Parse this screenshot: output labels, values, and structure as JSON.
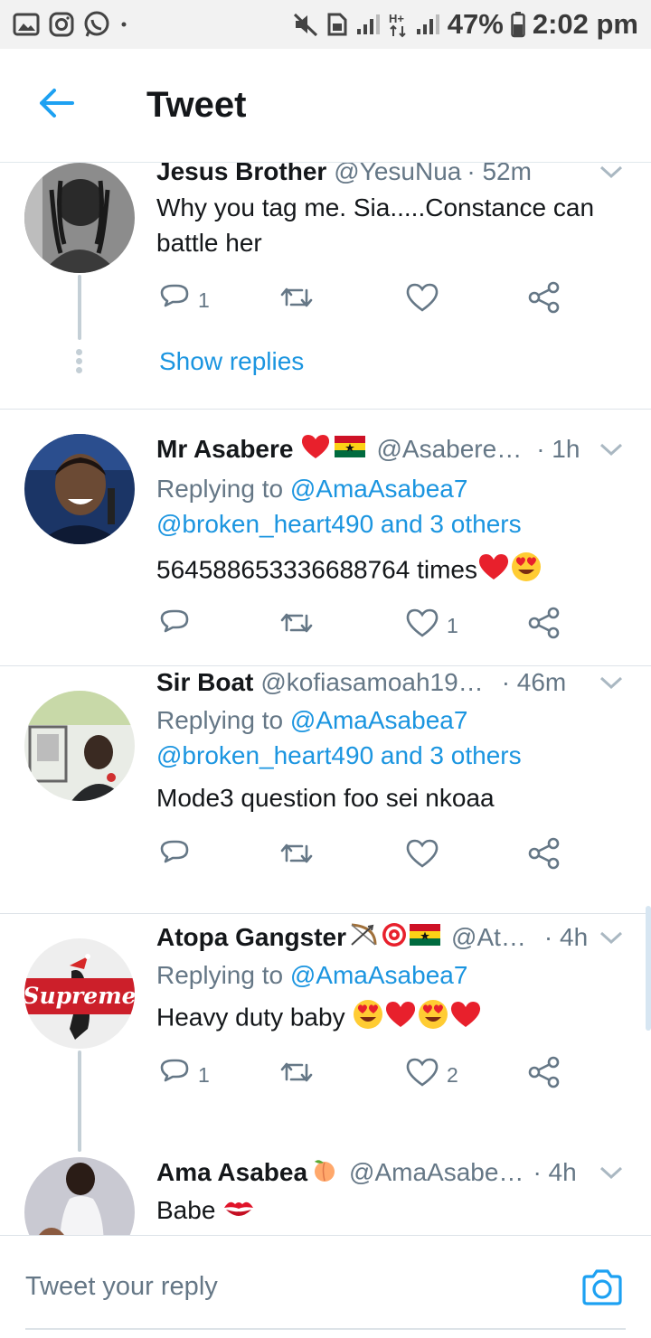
{
  "status_bar": {
    "left_icons": [
      "gallery-icon",
      "instagram-icon",
      "whatsapp-icon",
      "dot-icon"
    ],
    "right_icons": [
      "mute-icon",
      "sim-icon",
      "signal-icon",
      "hplus-icon",
      "signal-2-icon",
      "battery-icon"
    ],
    "battery": "47%",
    "time": "2:02 pm"
  },
  "header": {
    "title": "Tweet"
  },
  "tweets": [
    {
      "name": "Jesus Brother",
      "handle": "@YesuNua",
      "time": "· 52m",
      "text": "Why you tag me. Sia.....Constance can battle her",
      "reply_count": "1",
      "retweet_count": "",
      "like_count": "",
      "show_replies": "Show replies"
    },
    {
      "name": "Mr Asabere",
      "name_emoji": [
        "red-heart",
        "ghana-flag"
      ],
      "handle": "@Asabere…",
      "time": "· 1h",
      "replying_prefix": "Replying to",
      "replying_line1": "@AmaAsabea7",
      "replying_line2": "@broken_heart490 and 3 others",
      "text": "564588653336688764 times",
      "text_emoji": [
        "red-heart",
        "heart-eyes"
      ],
      "reply_count": "",
      "retweet_count": "",
      "like_count": "1"
    },
    {
      "name": "Sir Boat",
      "handle": "@kofiasamoah19…",
      "time": "· 46m",
      "replying_prefix": "Replying to",
      "replying_line1": "@AmaAsabea7",
      "replying_line2": "@broken_heart490 and 3 others",
      "text": "Mode3 question foo sei nkoaa",
      "reply_count": "",
      "retweet_count": "",
      "like_count": ""
    },
    {
      "name": "Atopa Gangster",
      "name_emoji": [
        "bow-and-arrow",
        "direct-hit",
        "ghana-flag"
      ],
      "handle": "@At…",
      "time": "· 4h",
      "replying_prefix": "Replying to",
      "replying_line1": "@AmaAsabea7",
      "text": "Heavy duty baby",
      "text_emoji": [
        "heart-eyes",
        "red-heart",
        "heart-eyes",
        "red-heart"
      ],
      "reply_count": "1",
      "retweet_count": "",
      "like_count": "2",
      "avatar_text": "Supreme"
    },
    {
      "name": "Ama Asabea",
      "name_emoji": [
        "peach"
      ],
      "handle": "@AmaAsabe…",
      "time": "· 4h",
      "text": "Babe",
      "text_emoji": [
        "kiss-mark"
      ]
    }
  ],
  "composer": {
    "placeholder": "Tweet your reply"
  },
  "colors": {
    "accent": "#1da1f2",
    "link": "#1b95e0",
    "secondary_text": "#657786",
    "divider": "#dde3e8"
  }
}
